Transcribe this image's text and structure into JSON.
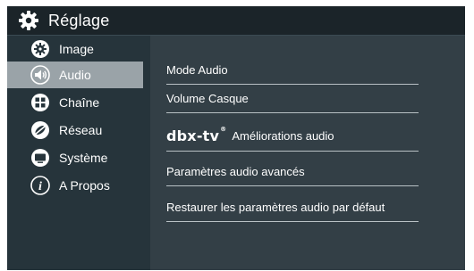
{
  "header": {
    "title": "Réglage",
    "icon": "gear-icon"
  },
  "sidebar": {
    "items": [
      {
        "label": "Image",
        "icon": "image-settings-icon"
      },
      {
        "label": "Audio",
        "icon": "speaker-icon",
        "selected": true
      },
      {
        "label": "Chaîne",
        "icon": "channel-grid-icon"
      },
      {
        "label": "Réseau",
        "icon": "network-icon"
      },
      {
        "label": "Système",
        "icon": "system-screen-icon"
      },
      {
        "label": "A Propos",
        "icon": "info-icon"
      }
    ]
  },
  "main": {
    "items": [
      {
        "label": "Mode Audio"
      },
      {
        "label": "Volume Casque"
      },
      {
        "label": "Améliorations audio",
        "logo_text": "dbx-tv",
        "logo_mark": "®"
      },
      {
        "label": "Paramètres audio avancés"
      },
      {
        "label": "Restaurer les paramètres audio par défaut"
      }
    ]
  },
  "colors": {
    "panel": "#26343b",
    "header": "#1b2429",
    "content": "#333f46",
    "selected": "#9aa3a8",
    "divider": "#b9c1c5",
    "text": "#ffffff"
  }
}
